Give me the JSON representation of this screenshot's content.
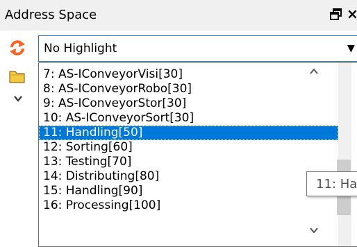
{
  "panel": {
    "title": "Address Space",
    "pin_icon": "pin-window-icon",
    "close_glyph": "×"
  },
  "toolbar": {
    "refresh_icon": "refresh-icon",
    "highlight_select": {
      "value": "No Highlight",
      "arrow_glyph": "▼"
    }
  },
  "tree": {
    "folder_icon": "folder-icon",
    "expander_icon": "chevron-down-icon"
  },
  "list": {
    "items": [
      {
        "label": "7: AS-IConveyorVisi[30]",
        "selected": false
      },
      {
        "label": "8: AS-IConveyorRobo[30]",
        "selected": false
      },
      {
        "label": "9: AS-IConveyorStor[30]",
        "selected": false
      },
      {
        "label": "10: AS-IConveyorSort[30]",
        "selected": false
      },
      {
        "label": "11: Handling[50]",
        "selected": true
      },
      {
        "label": "12: Sorting[60]",
        "selected": false
      },
      {
        "label": "13: Testing[70]",
        "selected": false
      },
      {
        "label": "14: Distributing[80]",
        "selected": false
      },
      {
        "label": "15: Handling[90]",
        "selected": false
      },
      {
        "label": "16: Processing[100]",
        "selected": false
      }
    ],
    "selected_index": 4
  },
  "tooltip": {
    "text": "11: Ha"
  },
  "colors": {
    "selection": "#0078d7",
    "combo_border": "#1f78d1",
    "refresh_orange": "#f26522",
    "folder_yellow": "#f5c842"
  }
}
